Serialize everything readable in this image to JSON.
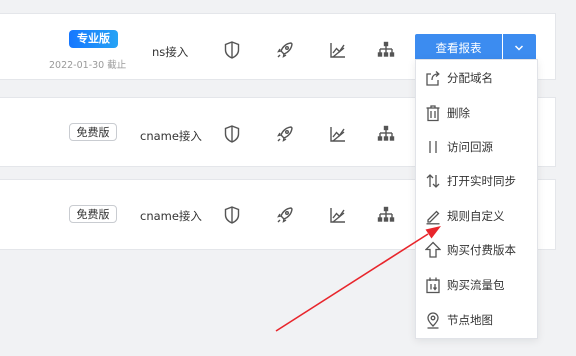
{
  "rows": [
    {
      "edition": "专业版",
      "expire_note": "2022-01-30 截止",
      "access_type": "ns接入",
      "action_button": "查看报表"
    },
    {
      "edition": "免费版",
      "access_type": "cname接入"
    },
    {
      "edition": "免费版",
      "access_type": "cname接入"
    }
  ],
  "row_icons": [
    "shield-icon",
    "rocket-icon",
    "line-chart-icon",
    "sitemap-icon"
  ],
  "dropdown_menu": {
    "items": [
      {
        "label": "分配域名",
        "icon": "share-icon"
      },
      {
        "label": "删除",
        "icon": "trash-icon"
      },
      {
        "label": "访问回源",
        "icon": "pause-icon"
      },
      {
        "label": "打开实时同步",
        "icon": "sync-arrows-icon"
      },
      {
        "label": "规则自定义",
        "icon": "pencil-icon"
      },
      {
        "label": "购买付费版本",
        "icon": "upgrade-arrow-icon"
      },
      {
        "label": "购买流量包",
        "icon": "package-icon"
      },
      {
        "label": "节点地图",
        "icon": "location-pin-icon"
      }
    ]
  },
  "colors": {
    "primary_button": "#3c8cf0",
    "pro_badge": "#1677ff",
    "annotation_arrow": "#e8262c",
    "page_background": "#f1f2f4"
  }
}
